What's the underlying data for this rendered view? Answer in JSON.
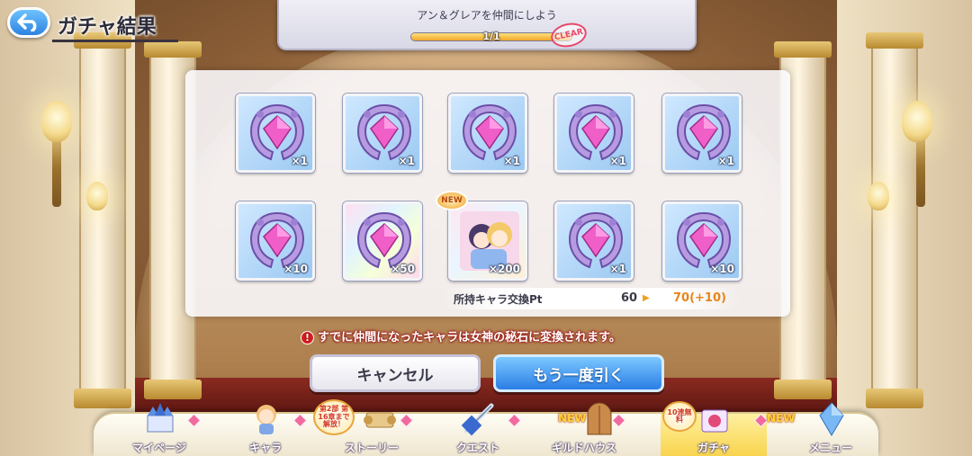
{
  "screen": {
    "title": "ガチャ結果"
  },
  "mission": {
    "title": "アン＆グレアを仲間にしよう",
    "count": "1/1",
    "progress": 1.0,
    "status": "CLEAR"
  },
  "results": [
    {
      "icon": "goddess-stone-icon",
      "count": "×1",
      "frame": "blue"
    },
    {
      "icon": "goddess-stone-icon",
      "count": "×1",
      "frame": "blue"
    },
    {
      "icon": "goddess-stone-icon",
      "count": "×1",
      "frame": "blue"
    },
    {
      "icon": "goddess-stone-icon",
      "count": "×1",
      "frame": "blue"
    },
    {
      "icon": "goddess-stone-icon",
      "count": "×1",
      "frame": "blue"
    },
    {
      "icon": "goddess-stone-icon",
      "count": "×10",
      "frame": "blue"
    },
    {
      "icon": "goddess-stone-icon",
      "count": "×50",
      "frame": "rainbow"
    },
    {
      "icon": "character-portrait-icon",
      "count": "×200",
      "frame": "rainbow",
      "badge": "NEW"
    },
    {
      "icon": "goddess-stone-icon",
      "count": "×1",
      "frame": "blue"
    },
    {
      "icon": "goddess-stone-icon",
      "count": "×10",
      "frame": "blue"
    }
  ],
  "exchange_pt": {
    "label": "所持キャラ交換Pt",
    "before": "60",
    "after": "70(+10)"
  },
  "notice": "すでに仲間になったキャラは女神の秘石に変換されます。",
  "buttons": {
    "cancel": "キャンセル",
    "again": "もう一度引く"
  },
  "nav": {
    "items": [
      {
        "label": "マイページ",
        "icon": "castle-icon"
      },
      {
        "label": "キャラ",
        "icon": "character-icon"
      },
      {
        "label": "ストーリー",
        "icon": "scroll-icon",
        "badge": "第2部 第16章まで解放！"
      },
      {
        "label": "クエスト",
        "icon": "sword-icon"
      },
      {
        "label": "ギルドハウス",
        "icon": "door-icon",
        "badge": "NEW"
      },
      {
        "label": "ガチャ",
        "icon": "gacha-icon",
        "badge": "10連無料",
        "active": true
      },
      {
        "label": "メニュー",
        "icon": "crystal-icon",
        "badge": "NEW"
      }
    ]
  },
  "colors": {
    "accent_blue": "#2a7ee6",
    "notice_red": "#d82020",
    "pt_after": "#e8851a",
    "nav_active": "#f8d34a"
  }
}
